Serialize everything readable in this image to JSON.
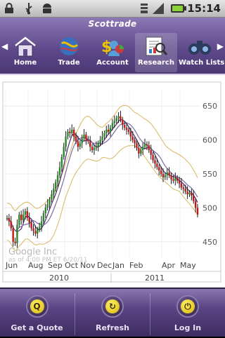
{
  "statusbar": {
    "time": "15:14",
    "icons": [
      "lock-icon",
      "usb-icon",
      "android-icon",
      "wifi-icon",
      "signal-icon",
      "battery-icon"
    ]
  },
  "header": {
    "brand": "Scottrade",
    "nav": [
      {
        "label": "Home",
        "icon": "home-icon",
        "active": false
      },
      {
        "label": "Trade",
        "icon": "globe-icon",
        "active": false
      },
      {
        "label": "Account",
        "icon": "account-icon",
        "active": false
      },
      {
        "label": "Research",
        "icon": "research-icon",
        "active": true
      },
      {
        "label": "Watch Lists",
        "icon": "binoculars-icon",
        "active": false
      }
    ]
  },
  "chart_data": {
    "type": "line",
    "title": "",
    "watermark_name": "Google Inc",
    "watermark_note": "as of 4:00 PM ET 6/20/11",
    "x_ticks": [
      "Jun",
      "Aug",
      "Sep",
      "Oct",
      "Nov",
      "Dec",
      "Jan",
      "Feb",
      "Apr",
      "May"
    ],
    "year_labels": [
      "2010",
      "2011"
    ],
    "y_ticks": [
      650,
      600,
      550,
      500,
      450
    ],
    "ylim": [
      425,
      675
    ],
    "series": [
      {
        "values": [
          485,
          480,
          470,
          450,
          448,
          475,
          490,
          482,
          490,
          495,
          485,
          478,
          470,
          466,
          462,
          468,
          472,
          480,
          492,
          500,
          505,
          512,
          520,
          528,
          538,
          548,
          560,
          575,
          590,
          605,
          612,
          610,
          615,
          605,
          598,
          590,
          595,
          602,
          608,
          600,
          598,
          590,
          585,
          588,
          590,
          595,
          600,
          605,
          610,
          615,
          612,
          618,
          625,
          628,
          632,
          635,
          630,
          622,
          618,
          615,
          612,
          605,
          600,
          595,
          588,
          580,
          585,
          590,
          594,
          592,
          585,
          578,
          570,
          565,
          560,
          555,
          550,
          545,
          548,
          552,
          548,
          542,
          540,
          544,
          540,
          536,
          530,
          528,
          524,
          520,
          522,
          518,
          510,
          500,
          490
        ]
      }
    ],
    "colors": {
      "price": "#1a1a1a",
      "up": "#2a8a2a",
      "down": "#c01818",
      "ma_short": "#4a2c6e",
      "ma_long": "#7e6aa0",
      "bands": "#d6b860"
    }
  },
  "bottombar": {
    "buttons": [
      {
        "label": "Get a Quote",
        "icon": "magnifier-icon",
        "glyph": "Q"
      },
      {
        "label": "Refresh",
        "icon": "refresh-icon",
        "glyph": "↻"
      },
      {
        "label": "Log In",
        "icon": "power-icon",
        "glyph": "⏻"
      }
    ]
  }
}
